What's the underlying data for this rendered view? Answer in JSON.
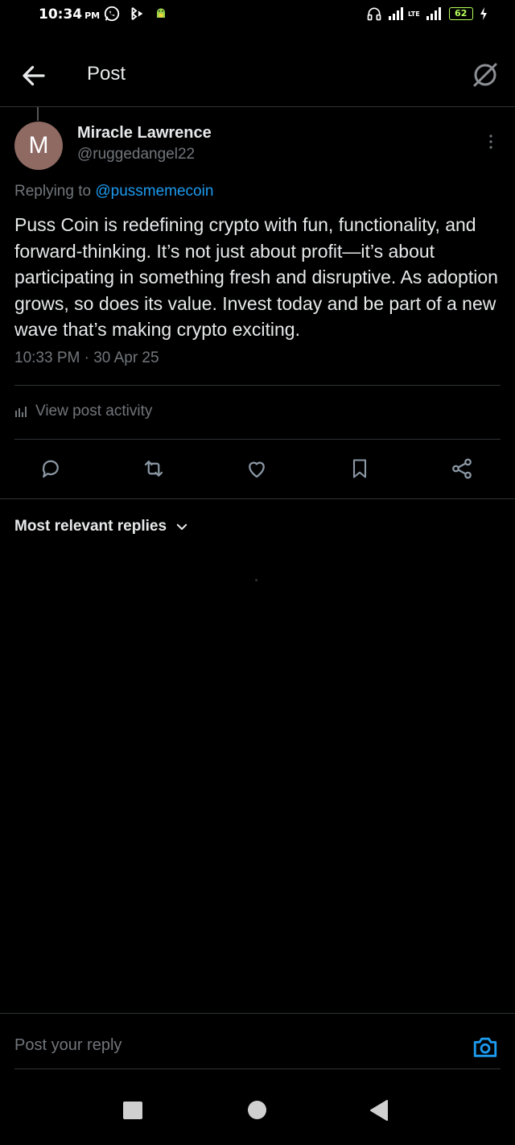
{
  "status_bar": {
    "time": "10:34",
    "ampm": "PM",
    "battery": "62",
    "network_label": "LTE"
  },
  "header": {
    "title": "Post"
  },
  "post": {
    "author_initial": "M",
    "author_name": "Miracle Lawrence",
    "author_handle": "@ruggedangel22",
    "replying_prefix": "Replying to ",
    "replying_mention": "@pussmemecoin",
    "text": "Puss Coin is redefining crypto with fun, functionality, and forward-thinking. It’s not just about profit—it’s about participating in something fresh and disruptive. As adoption grows, so does its value. Invest today and be part of a new wave that’s making crypto exciting.",
    "timestamp": "10:33 PM · 30 Apr 25"
  },
  "activity": {
    "label": "View post activity"
  },
  "actions": {
    "icons": [
      "reply-icon",
      "repost-icon",
      "like-icon",
      "bookmark-icon",
      "share-icon"
    ]
  },
  "replies": {
    "filter_label": "Most relevant replies"
  },
  "composer": {
    "placeholder": "Post your reply"
  },
  "colors": {
    "background": "#000000",
    "text": "#e7e9ea",
    "muted": "#71767b",
    "accent": "#1d9bf0",
    "divider": "#2f3336",
    "avatar": "#8e6a63"
  }
}
